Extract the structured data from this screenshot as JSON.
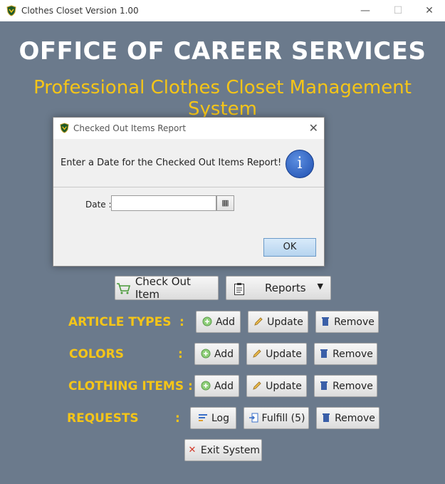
{
  "window": {
    "title": "Clothes Closet Version 1.00",
    "minimize": "—",
    "maximize": "☐",
    "close": "✕"
  },
  "header": {
    "title": "OFFICE OF CAREER SERVICES",
    "subtitle": "Professional Clothes Closet Management System"
  },
  "main": {
    "checkout_label": "Check Out Item",
    "reports_label": "Reports",
    "rows": [
      {
        "label": "ARTICLE TYPES",
        "colon": ":",
        "buttons": [
          "Add",
          "Update",
          "Remove"
        ]
      },
      {
        "label": "COLORS",
        "colon": ":",
        "buttons": [
          "Add",
          "Update",
          "Remove"
        ]
      },
      {
        "label": "CLOTHING ITEMS :",
        "colon": "",
        "buttons": [
          "Add",
          "Update",
          "Remove"
        ]
      },
      {
        "label": "REQUESTS",
        "colon": ":",
        "buttons": [
          "Log",
          "Fulfill (5)",
          "Remove"
        ]
      }
    ],
    "exit_label": "Exit System"
  },
  "dialog": {
    "title": "Checked Out Items Report",
    "close": "✕",
    "message": "Enter a Date for the Checked Out Items Report!",
    "date_label": "Date :",
    "date_value": "",
    "ok_label": "OK"
  },
  "colors": {
    "background": "#6b7a8c",
    "accent": "#f5c518"
  }
}
